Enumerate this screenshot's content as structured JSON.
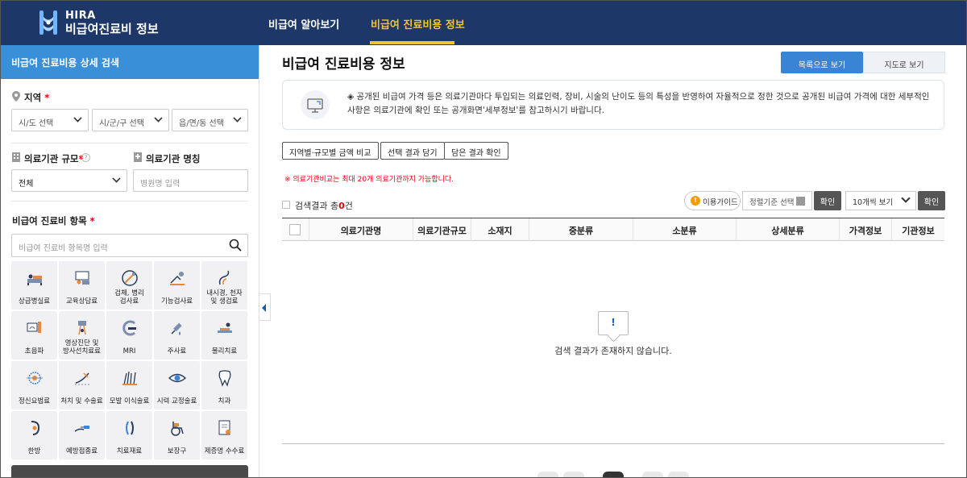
{
  "header": {
    "logo_line1": "HIRA",
    "logo_line2": "비급여진료비 정보",
    "nav": [
      "비급여 알아보기",
      "비급여 진료비용 정보"
    ],
    "active_nav": "비급여 진료비용 정보",
    "accent_color": "#f4c430",
    "bg_color": "#1d3868"
  },
  "sidebar": {
    "title": "비급여 진료비용 상세 검색",
    "region": {
      "label": "지역",
      "required": "*",
      "selects": [
        "시/도 선택",
        "시/군/구 선택",
        "읍/면/동 선택"
      ]
    },
    "scale": {
      "label": "의료기관 규모",
      "required": "*",
      "value": "전체"
    },
    "name": {
      "label": "의료기관 명칭",
      "placeholder": "병원명 입력"
    },
    "items": {
      "label": "비급여 진료비 항목",
      "required": "*",
      "placeholder": "비급여 진료비 항목명 입력"
    },
    "tiles": [
      {
        "label": "상급병실료",
        "icon": "hospital-bed-icon"
      },
      {
        "label": "교육상담료",
        "icon": "consultation-icon"
      },
      {
        "label": "검체, 병리\n검사료",
        "icon": "specimen-test-icon"
      },
      {
        "label": "기능검사료",
        "icon": "function-test-icon"
      },
      {
        "label": "내시경, 천자\n및 생검료",
        "icon": "endoscope-icon"
      },
      {
        "label": "초음파",
        "icon": "ultrasound-icon"
      },
      {
        "label": "영상진단 및\n방사선치료료",
        "icon": "radiology-icon"
      },
      {
        "label": "MRI",
        "icon": "mri-icon"
      },
      {
        "label": "주사료",
        "icon": "syringe-icon"
      },
      {
        "label": "물리치료",
        "icon": "physical-therapy-icon"
      },
      {
        "label": "정신요법료",
        "icon": "psychotherapy-icon"
      },
      {
        "label": "처치 및 수술료",
        "icon": "surgery-icon"
      },
      {
        "label": "모발 이식술료",
        "icon": "hair-transplant-icon"
      },
      {
        "label": "시력 교정술료",
        "icon": "eye-icon"
      },
      {
        "label": "치과",
        "icon": "tooth-icon"
      },
      {
        "label": "한방",
        "icon": "oriental-medicine-icon"
      },
      {
        "label": "예방접종료",
        "icon": "vaccination-icon"
      },
      {
        "label": "치료재료",
        "icon": "treatment-material-icon"
      },
      {
        "label": "보장구",
        "icon": "wheelchair-icon"
      },
      {
        "label": "제증명 수수료",
        "icon": "certificate-icon"
      }
    ]
  },
  "main": {
    "title": "비급여 진료비용 정보",
    "view_list_label": "목록으로 보기",
    "view_map_label": "지도로 보기",
    "notice": "◈ 공개된 비급여 가격 등은 의료기관마다 투입되는 의료인력, 장비, 시술의 난이도 등의 특성을 반영하여 자율적으로 정한 것으로 공개된 비급여 가격에 대한 세부적인 사항은 의료기관에 확인 또는 공개화면'세부정보'를 참고하시기 바랍니다.",
    "tool_buttons": [
      "지역별·규모별 금액 비교",
      "선택 결과 담기",
      "담은 결과 확인"
    ],
    "warning": "※ 의료기관비교는 최대 20개 의료기관까지 가능합니다.",
    "result_prefix": "검색결과 총",
    "result_count": "0",
    "result_suffix": "건",
    "guide_label": "이용가이드",
    "sort_label": "정렬기준 선택",
    "confirm_label": "확인",
    "per_page": "10개씩 보기",
    "columns": [
      "의료기관명",
      "의료기관규모",
      "소재지",
      "중분류",
      "소분류",
      "상세분류",
      "가격정보",
      "기관정보"
    ],
    "empty_icon": "!",
    "empty_text": "검색 결과가 존재하지 않습니다."
  }
}
